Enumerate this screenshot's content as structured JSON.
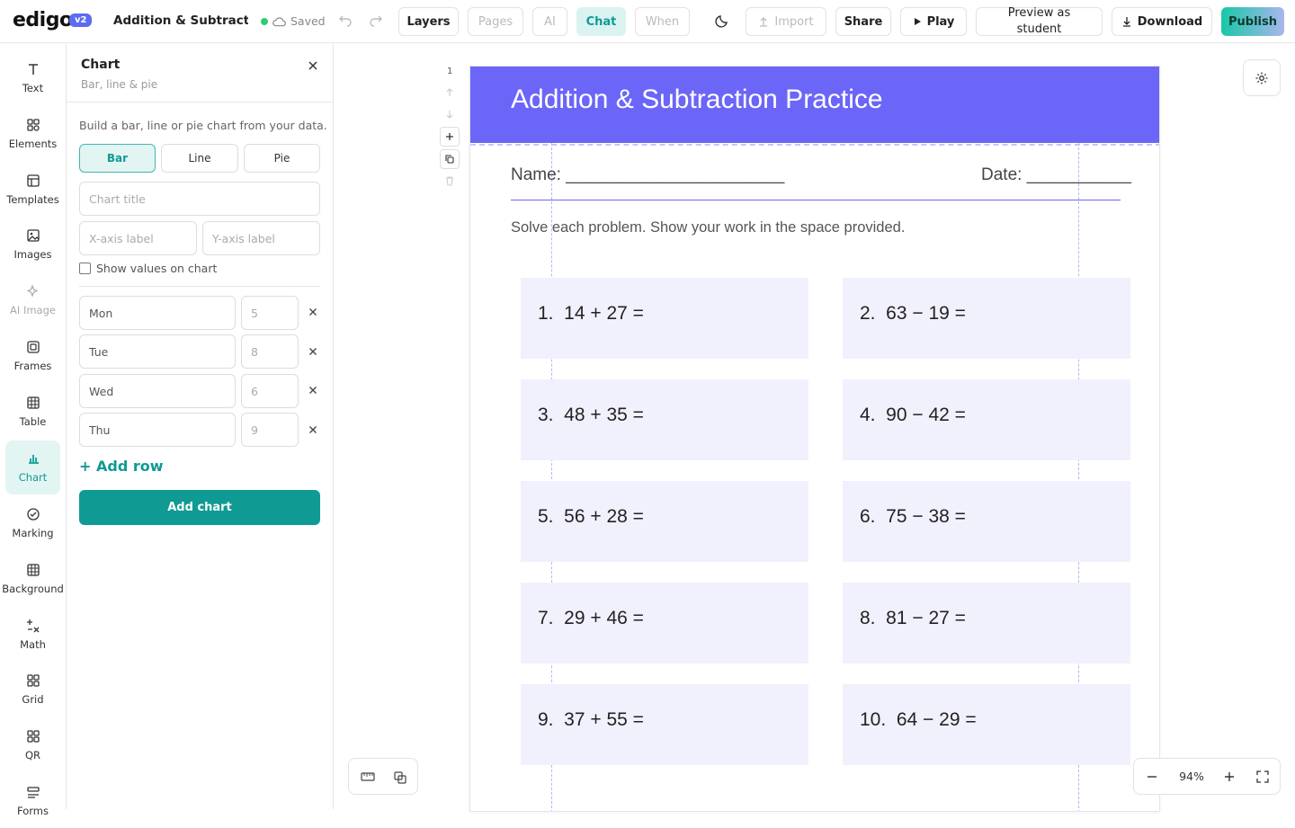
{
  "topbar": {
    "logo": "edigo",
    "version": "v2",
    "doc_title": "Addition & Subtraction Practice",
    "saved": "Saved",
    "layers": "Layers",
    "pages": "Pages",
    "ai": "AI",
    "chat": "Chat",
    "when": "When",
    "import": "Import",
    "share": "Share",
    "play": "Play",
    "preview": "Preview as student",
    "download": "Download",
    "publish": "Publish"
  },
  "rail": [
    {
      "label": "Text",
      "icon": "text-icon"
    },
    {
      "label": "Elements",
      "icon": "elements-icon"
    },
    {
      "label": "Templates",
      "icon": "templates-icon"
    },
    {
      "label": "Images",
      "icon": "image-icon"
    },
    {
      "label": "AI Image",
      "icon": "sparkle-icon"
    },
    {
      "label": "Frames",
      "icon": "frame-icon"
    },
    {
      "label": "Table",
      "icon": "table-icon"
    },
    {
      "label": "Chart",
      "icon": "chart-icon"
    },
    {
      "label": "Marking",
      "icon": "check-circle-icon"
    },
    {
      "label": "Background",
      "icon": "grid-icon"
    },
    {
      "label": "Math",
      "icon": "math-icon"
    },
    {
      "label": "Grid",
      "icon": "grid-squares-icon"
    },
    {
      "label": "QR",
      "icon": "qr-icon"
    },
    {
      "label": "Forms",
      "icon": "forms-icon"
    }
  ],
  "panel": {
    "title": "Chart",
    "subtitle": "Bar, line & pie",
    "description": "Build a bar, line or pie chart from your data.",
    "types": [
      "Bar",
      "Line",
      "Pie"
    ],
    "active_type": "Bar",
    "chart_title_placeholder": "Chart title",
    "xaxis_placeholder": "X-axis label",
    "yaxis_placeholder": "Y-axis label",
    "show_values": "Show values on chart",
    "show_values_checked": false,
    "rows": [
      {
        "label": "Mon",
        "value": "5"
      },
      {
        "label": "Tue",
        "value": "8"
      },
      {
        "label": "Wed",
        "value": "6"
      },
      {
        "label": "Thu",
        "value": "9"
      }
    ],
    "add_row": "+ Add row",
    "add_chart": "Add chart"
  },
  "canvas": {
    "page_number": "1",
    "worksheet": {
      "title": "Addition & Subtraction Practice",
      "name_label": "Name: _______________________",
      "date_label": "Date: ___________",
      "instructions": "Solve each problem. Show your work in the space provided.",
      "problems": [
        "1.  14 + 27 =",
        "2.  63 − 19 =",
        "3.  48 + 35 =",
        "4.  90 − 42 =",
        "5.  56 + 28 =",
        "6.  75 − 38 =",
        "7.  29 + 46 =",
        "8.  81 − 27 =",
        "9.  37 + 55 =",
        "10.  64 − 29 ="
      ]
    },
    "zoom": "94%"
  },
  "colors": {
    "accent": "#0f9b94",
    "banner": "#6b66f7",
    "problem_bg": "#f1f0fd"
  }
}
